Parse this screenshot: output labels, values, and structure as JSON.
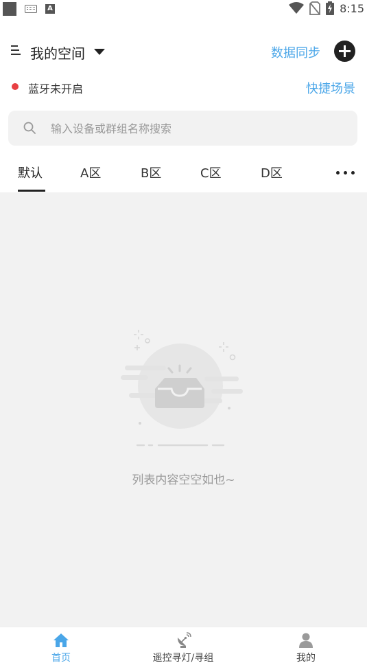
{
  "status_bar": {
    "time": "8:15",
    "icons": [
      "notification-square-icon",
      "keyboard-icon",
      "font-a-icon",
      "wifi-icon",
      "no-sim-icon",
      "battery-charging-icon"
    ]
  },
  "header": {
    "space_title": "我的空间",
    "sync_label": "数据同步",
    "icons": {
      "menu": "menu-icon",
      "caret": "caret-down-icon",
      "add": "plus-circle-icon"
    }
  },
  "bluetooth": {
    "status_text": "蓝牙未开启",
    "quick_scene_label": "快捷场景",
    "status_color": "#e84043"
  },
  "search": {
    "placeholder": "输入设备或群组名称搜索",
    "value": ""
  },
  "tabs": {
    "items": [
      {
        "label": "默认",
        "active": true
      },
      {
        "label": "A区",
        "active": false
      },
      {
        "label": "B区",
        "active": false
      },
      {
        "label": "C区",
        "active": false
      },
      {
        "label": "D区",
        "active": false
      }
    ],
    "more_icon": "more-horizontal-icon"
  },
  "empty_state": {
    "message": "列表内容空空如也~",
    "icon": "empty-inbox-icon"
  },
  "bottom_nav": {
    "items": [
      {
        "label": "首页",
        "icon": "home-icon",
        "active": true
      },
      {
        "label": "遥控寻灯/寻组",
        "icon": "satellite-dish-icon",
        "active": false
      },
      {
        "label": "我的",
        "icon": "user-icon",
        "active": false
      }
    ]
  },
  "colors": {
    "accent": "#4aa6e8",
    "content_bg": "#f2f2f2",
    "alert": "#e84043"
  }
}
